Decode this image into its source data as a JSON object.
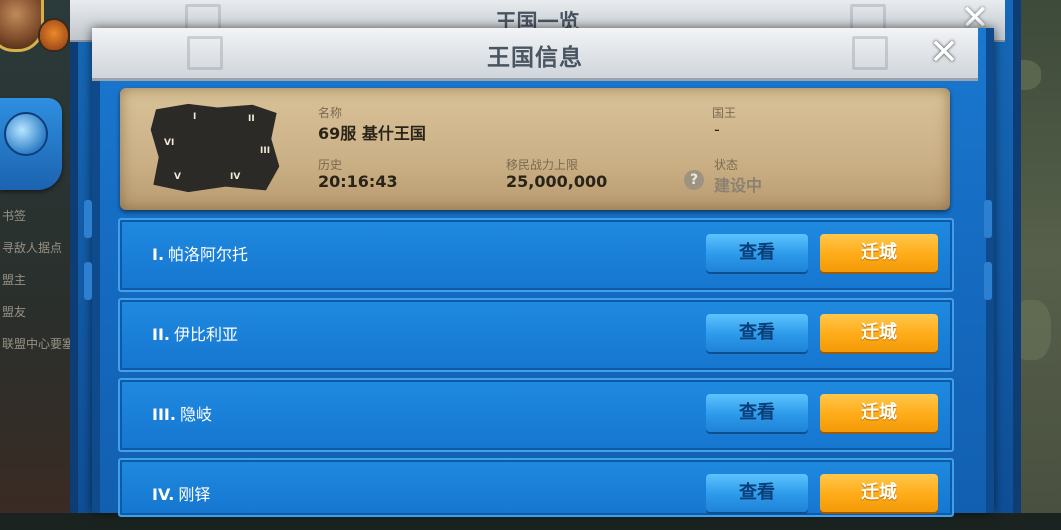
{
  "back_window": {
    "title": "王国一览",
    "close_glyph": "✕"
  },
  "sidebar": {
    "items": [
      "书签",
      "寻敌人据点",
      "盟主",
      "盟友",
      "联盟中心要塞"
    ]
  },
  "window": {
    "title": "王国信息",
    "close_glyph": "✕"
  },
  "kingdom": {
    "map_regions": [
      "I",
      "II",
      "III",
      "IV",
      "V",
      "VI"
    ],
    "name_label": "名称",
    "name_value": "69服 基什王国",
    "king_label": "国王",
    "king_value": "-",
    "history_label": "历史",
    "history_value": "20:16:43",
    "limit_label": "移民战力上限",
    "limit_value": "25,000,000",
    "status_label": "状态",
    "status_value": "建设中",
    "help_glyph": "?"
  },
  "regions": [
    {
      "numeral": "I.",
      "name": "帕洛阿尔托",
      "view": "查看",
      "move": "迁城"
    },
    {
      "numeral": "II.",
      "name": "伊比利亚",
      "view": "查看",
      "move": "迁城"
    },
    {
      "numeral": "III.",
      "name": "隐岐",
      "view": "查看",
      "move": "迁城"
    },
    {
      "numeral": "IV.",
      "name": "刚铎",
      "view": "查看",
      "move": "迁城"
    }
  ]
}
